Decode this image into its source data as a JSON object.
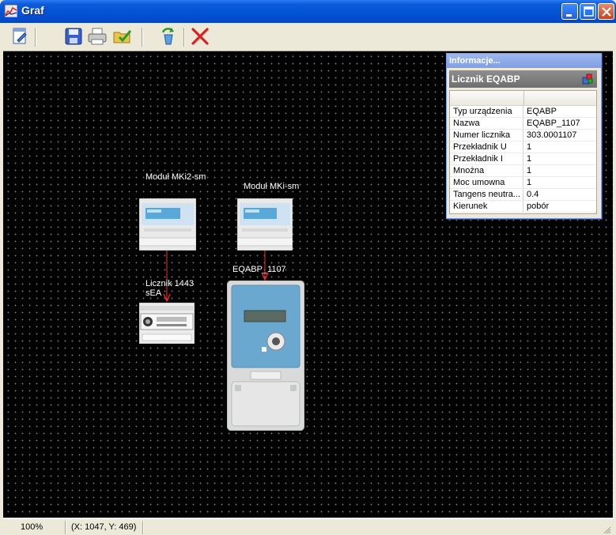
{
  "window": {
    "title": "Graf",
    "app_icon": "chart-icon",
    "buttons": [
      "minimize-icon",
      "maximize-icon",
      "close-icon"
    ]
  },
  "toolbar": {
    "items": [
      {
        "name": "edit-button",
        "icon": "edit-document-icon"
      },
      {
        "name": "save-button",
        "icon": "floppy-disk-icon"
      },
      {
        "name": "print-button",
        "icon": "printer-icon"
      },
      {
        "name": "open-folder-button",
        "icon": "folder-check-icon"
      },
      {
        "name": "refresh-button",
        "icon": "recycle-icon"
      },
      {
        "name": "delete-button",
        "icon": "red-x-icon"
      }
    ]
  },
  "graph": {
    "nodes": [
      {
        "id": "mki2",
        "label": "Moduł MKi2-sm"
      },
      {
        "id": "mki",
        "label": "Moduł MKi-sm"
      },
      {
        "id": "l1443",
        "label": "Licznik 1443 sEA"
      },
      {
        "id": "eqabp",
        "label": "EQABP_1107"
      }
    ],
    "edges": [
      {
        "from": "mki2",
        "to": "l1443"
      },
      {
        "from": "mki",
        "to": "eqabp"
      }
    ],
    "colors": {
      "background": "#000000",
      "grid_dot": "#6f6f6f",
      "edge": "#ff2a2a",
      "label": "#ffffff"
    }
  },
  "info_panel": {
    "title": "Informacje...",
    "header": "Licznik EQABP",
    "rows": [
      {
        "key": "Typ urządzenia",
        "value": "EQABP"
      },
      {
        "key": "Nazwa",
        "value": "EQABP_1107"
      },
      {
        "key": "Numer licznika",
        "value": "303.0001107"
      },
      {
        "key": "Przekładnik U",
        "value": "1"
      },
      {
        "key": "Przekładnik I",
        "value": "1"
      },
      {
        "key": "Mnożna",
        "value": "1"
      },
      {
        "key": "Moc umowna",
        "value": "1"
      },
      {
        "key": "Tangens neutra...",
        "value": "0.4"
      },
      {
        "key": "Kierunek",
        "value": "pobór"
      }
    ]
  },
  "status": {
    "zoom": "100%",
    "coords": "(X: 1047, Y: 469)"
  }
}
